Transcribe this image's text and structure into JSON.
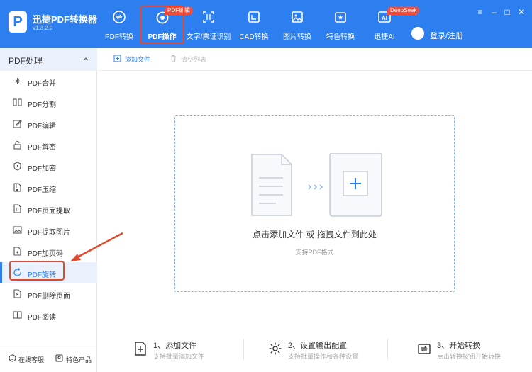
{
  "app": {
    "logo_letter": "P",
    "title": "迅捷PDF转换器",
    "version": "v1.3.2.0"
  },
  "nav": [
    {
      "label": "PDF转换",
      "icon": "convert-icon"
    },
    {
      "label": "PDF操作",
      "icon": "pdf-operate-icon",
      "badge": "PDF编辑"
    },
    {
      "label": "文字/票证识别",
      "icon": "ocr-icon"
    },
    {
      "label": "CAD转换",
      "icon": "cad-icon"
    },
    {
      "label": "图片转换",
      "icon": "image-icon"
    },
    {
      "label": "特色转换",
      "icon": "special-convert-icon"
    },
    {
      "label": "迅捷AI",
      "icon": "ai-icon",
      "badge": "DeepSeek"
    }
  ],
  "user": {
    "login_label": "登录/注册"
  },
  "sidebar": {
    "header": "PDF处理",
    "items": [
      {
        "label": "PDF合并",
        "icon": "merge-icon"
      },
      {
        "label": "PDF分割",
        "icon": "split-icon"
      },
      {
        "label": "PDF编辑",
        "icon": "edit-icon"
      },
      {
        "label": "PDF解密",
        "icon": "unlock-icon"
      },
      {
        "label": "PDF加密",
        "icon": "shield-icon"
      },
      {
        "label": "PDF压缩",
        "icon": "compress-icon"
      },
      {
        "label": "PDF页面提取",
        "icon": "page-extract-icon"
      },
      {
        "label": "PDF提取图片",
        "icon": "image-extract-icon"
      },
      {
        "label": "PDF加页码",
        "icon": "page-number-icon"
      },
      {
        "label": "PDF旋转",
        "icon": "rotate-icon",
        "active": true
      },
      {
        "label": "PDF删除页面",
        "icon": "delete-page-icon"
      },
      {
        "label": "PDF阅读",
        "icon": "read-icon"
      }
    ],
    "footer": {
      "service": "在线客服",
      "features": "特色产品"
    }
  },
  "toolbar": {
    "add_file": "添加文件",
    "clear_list": "清空列表"
  },
  "dropzone": {
    "main": "点击添加文件 或 拖拽文件到此处",
    "sub": "支持PDF格式"
  },
  "steps": [
    {
      "title": "1、添加文件",
      "desc": "支持批量添加文件",
      "icon": "add-file-icon"
    },
    {
      "title": "2、设置输出配置",
      "desc": "支持批量操作和各种设置",
      "icon": "settings-gear-icon"
    },
    {
      "title": "3、开始转换",
      "desc": "点击转换按钮开始转换",
      "icon": "start-convert-icon"
    }
  ],
  "colors": {
    "primary": "#2d7ff0",
    "annotation_red": "#e04a2c",
    "badge_red": "#ef4c3d"
  }
}
